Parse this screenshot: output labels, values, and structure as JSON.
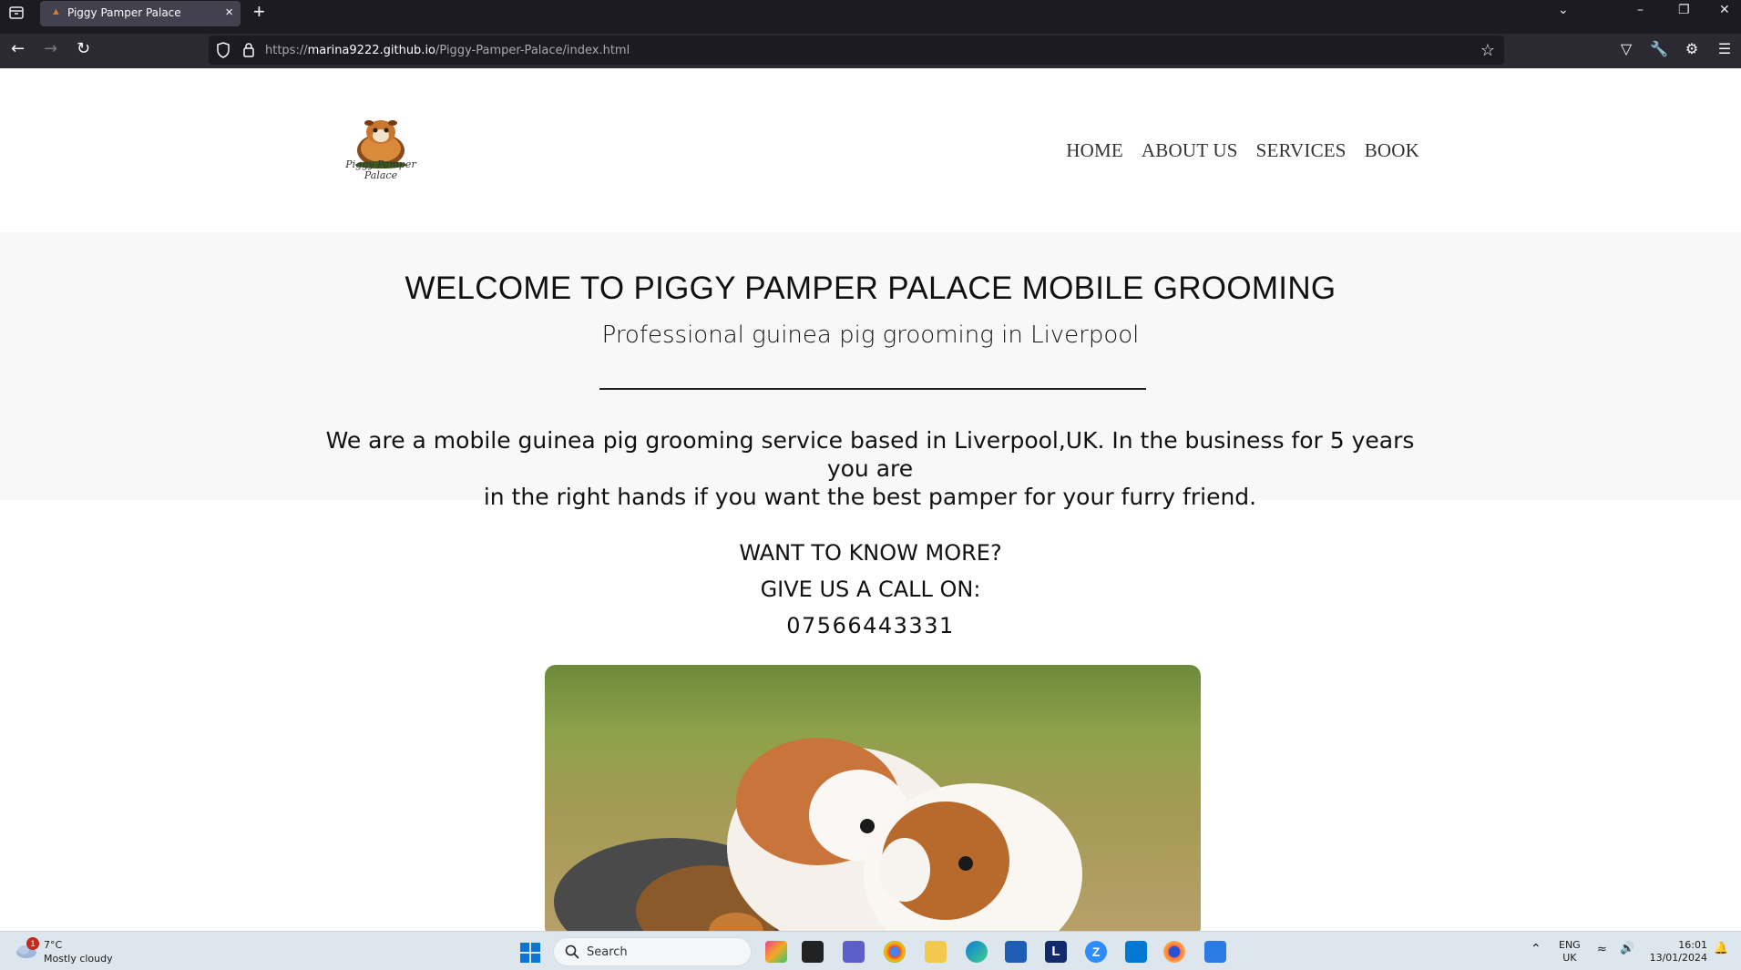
{
  "browser": {
    "tab_title": "Piggy Pamper Palace",
    "url_prefix": "https://",
    "url_host": "marina9222.github.io",
    "url_path": "/Piggy-Pamper-Palace/index.html"
  },
  "site": {
    "logo_text_line1": "Piggy Pamper",
    "logo_text_line2": "Palace",
    "nav": [
      "HOME",
      "ABOUT US",
      "SERVICES",
      "BOOK"
    ],
    "hero": {
      "title": "WELCOME TO PIGGY PAMPER PALACE MOBILE GROOMING",
      "subtitle": "Professional guinea pig grooming in Liverpool",
      "intro_line1": "We are a mobile guinea pig grooming service based in Liverpool,UK. In the business for 5 years you are",
      "intro_line2": "in the right hands if you want the best pamper for your furry friend."
    },
    "contact": {
      "line1": "WANT TO KNOW MORE?",
      "line2": "GIVE US A CALL ON:",
      "phone": "07566443331"
    }
  },
  "taskbar": {
    "weather_temp": "7°C",
    "weather_desc": "Mostly cloudy",
    "weather_badge": "1",
    "search_placeholder": "Search",
    "lang1": "ENG",
    "lang2": "UK",
    "time": "16:01",
    "date": "13/01/2024"
  }
}
